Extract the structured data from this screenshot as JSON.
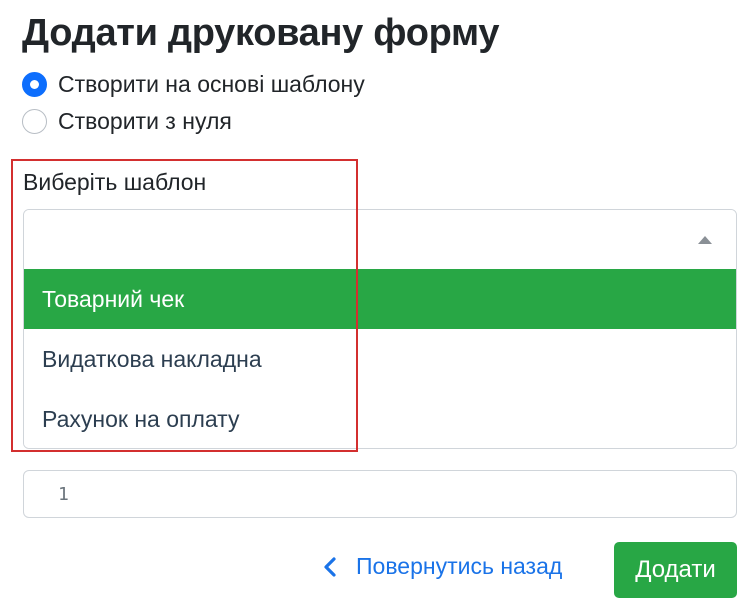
{
  "page": {
    "title": "Додати друковану форму"
  },
  "mode": {
    "options": [
      {
        "label": "Створити на основі шаблону",
        "checked": true
      },
      {
        "label": "Створити з нуля",
        "checked": false
      }
    ]
  },
  "template_select": {
    "label": "Виберіть шаблон",
    "value": "",
    "options": [
      {
        "label": "Товарний чек",
        "highlighted": true
      },
      {
        "label": "Видаткова накладна",
        "highlighted": false
      },
      {
        "label": "Рахунок на оплату",
        "highlighted": false
      }
    ]
  },
  "number_field": {
    "value": "1"
  },
  "footer": {
    "back_label": "Повернутись назад",
    "submit_label": "Додати"
  },
  "colors": {
    "primary_blue": "#0d6efd",
    "success_green": "#28a745",
    "link_blue": "#1a73e8",
    "highlight_red": "#d32f2f"
  },
  "icons": {
    "back": "chevron-left-icon",
    "dropdown": "caret-up-icon"
  }
}
